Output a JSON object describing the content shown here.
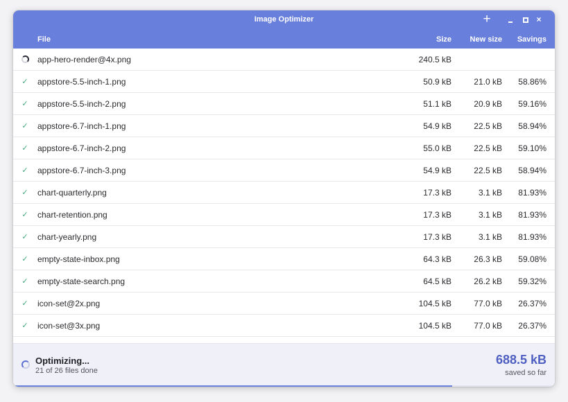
{
  "window": {
    "title": "Image Optimizer"
  },
  "header": {
    "add_icon": "plus-icon",
    "columns": {
      "file": "File",
      "size": "Size",
      "new_size": "New size",
      "savings": "Savings"
    }
  },
  "rows": [
    {
      "status": "processing",
      "file": "app-hero-render@4x.png",
      "size": "240.5 kB",
      "new_size": "",
      "savings": ""
    },
    {
      "status": "done",
      "file": "appstore-5.5-inch-1.png",
      "size": "50.9 kB",
      "new_size": "21.0 kB",
      "savings": "58.86%"
    },
    {
      "status": "done",
      "file": "appstore-5.5-inch-2.png",
      "size": "51.1 kB",
      "new_size": "20.9 kB",
      "savings": "59.16%"
    },
    {
      "status": "done",
      "file": "appstore-6.7-inch-1.png",
      "size": "54.9 kB",
      "new_size": "22.5 kB",
      "savings": "58.94%"
    },
    {
      "status": "done",
      "file": "appstore-6.7-inch-2.png",
      "size": "55.0 kB",
      "new_size": "22.5 kB",
      "savings": "59.10%"
    },
    {
      "status": "done",
      "file": "appstore-6.7-inch-3.png",
      "size": "54.9 kB",
      "new_size": "22.5 kB",
      "savings": "58.94%"
    },
    {
      "status": "done",
      "file": "chart-quarterly.png",
      "size": "17.3 kB",
      "new_size": "3.1 kB",
      "savings": "81.93%"
    },
    {
      "status": "done",
      "file": "chart-retention.png",
      "size": "17.3 kB",
      "new_size": "3.1 kB",
      "savings": "81.93%"
    },
    {
      "status": "done",
      "file": "chart-yearly.png",
      "size": "17.3 kB",
      "new_size": "3.1 kB",
      "savings": "81.93%"
    },
    {
      "status": "done",
      "file": "empty-state-inbox.png",
      "size": "64.3 kB",
      "new_size": "26.3 kB",
      "savings": "59.08%"
    },
    {
      "status": "done",
      "file": "empty-state-search.png",
      "size": "64.5 kB",
      "new_size": "26.2 kB",
      "savings": "59.32%"
    },
    {
      "status": "done",
      "file": "icon-set@2x.png",
      "size": "104.5 kB",
      "new_size": "77.0 kB",
      "savings": "26.37%"
    },
    {
      "status": "done",
      "file": "icon-set@3x.png",
      "size": "104.5 kB",
      "new_size": "77.0 kB",
      "savings": "26.37%"
    },
    {
      "status": "done",
      "file": "",
      "size": "",
      "new_size": "",
      "savings": ""
    }
  ],
  "footer": {
    "title": "Optimizing...",
    "subtitle": "21 of 26 files done",
    "amount": "688.5 kB",
    "amount_label": "saved so far",
    "progress_fraction": 0.81
  },
  "colors": {
    "header_bg": "#687fdb",
    "accent": "#4f5fc1",
    "done_check": "#3daa7d"
  }
}
